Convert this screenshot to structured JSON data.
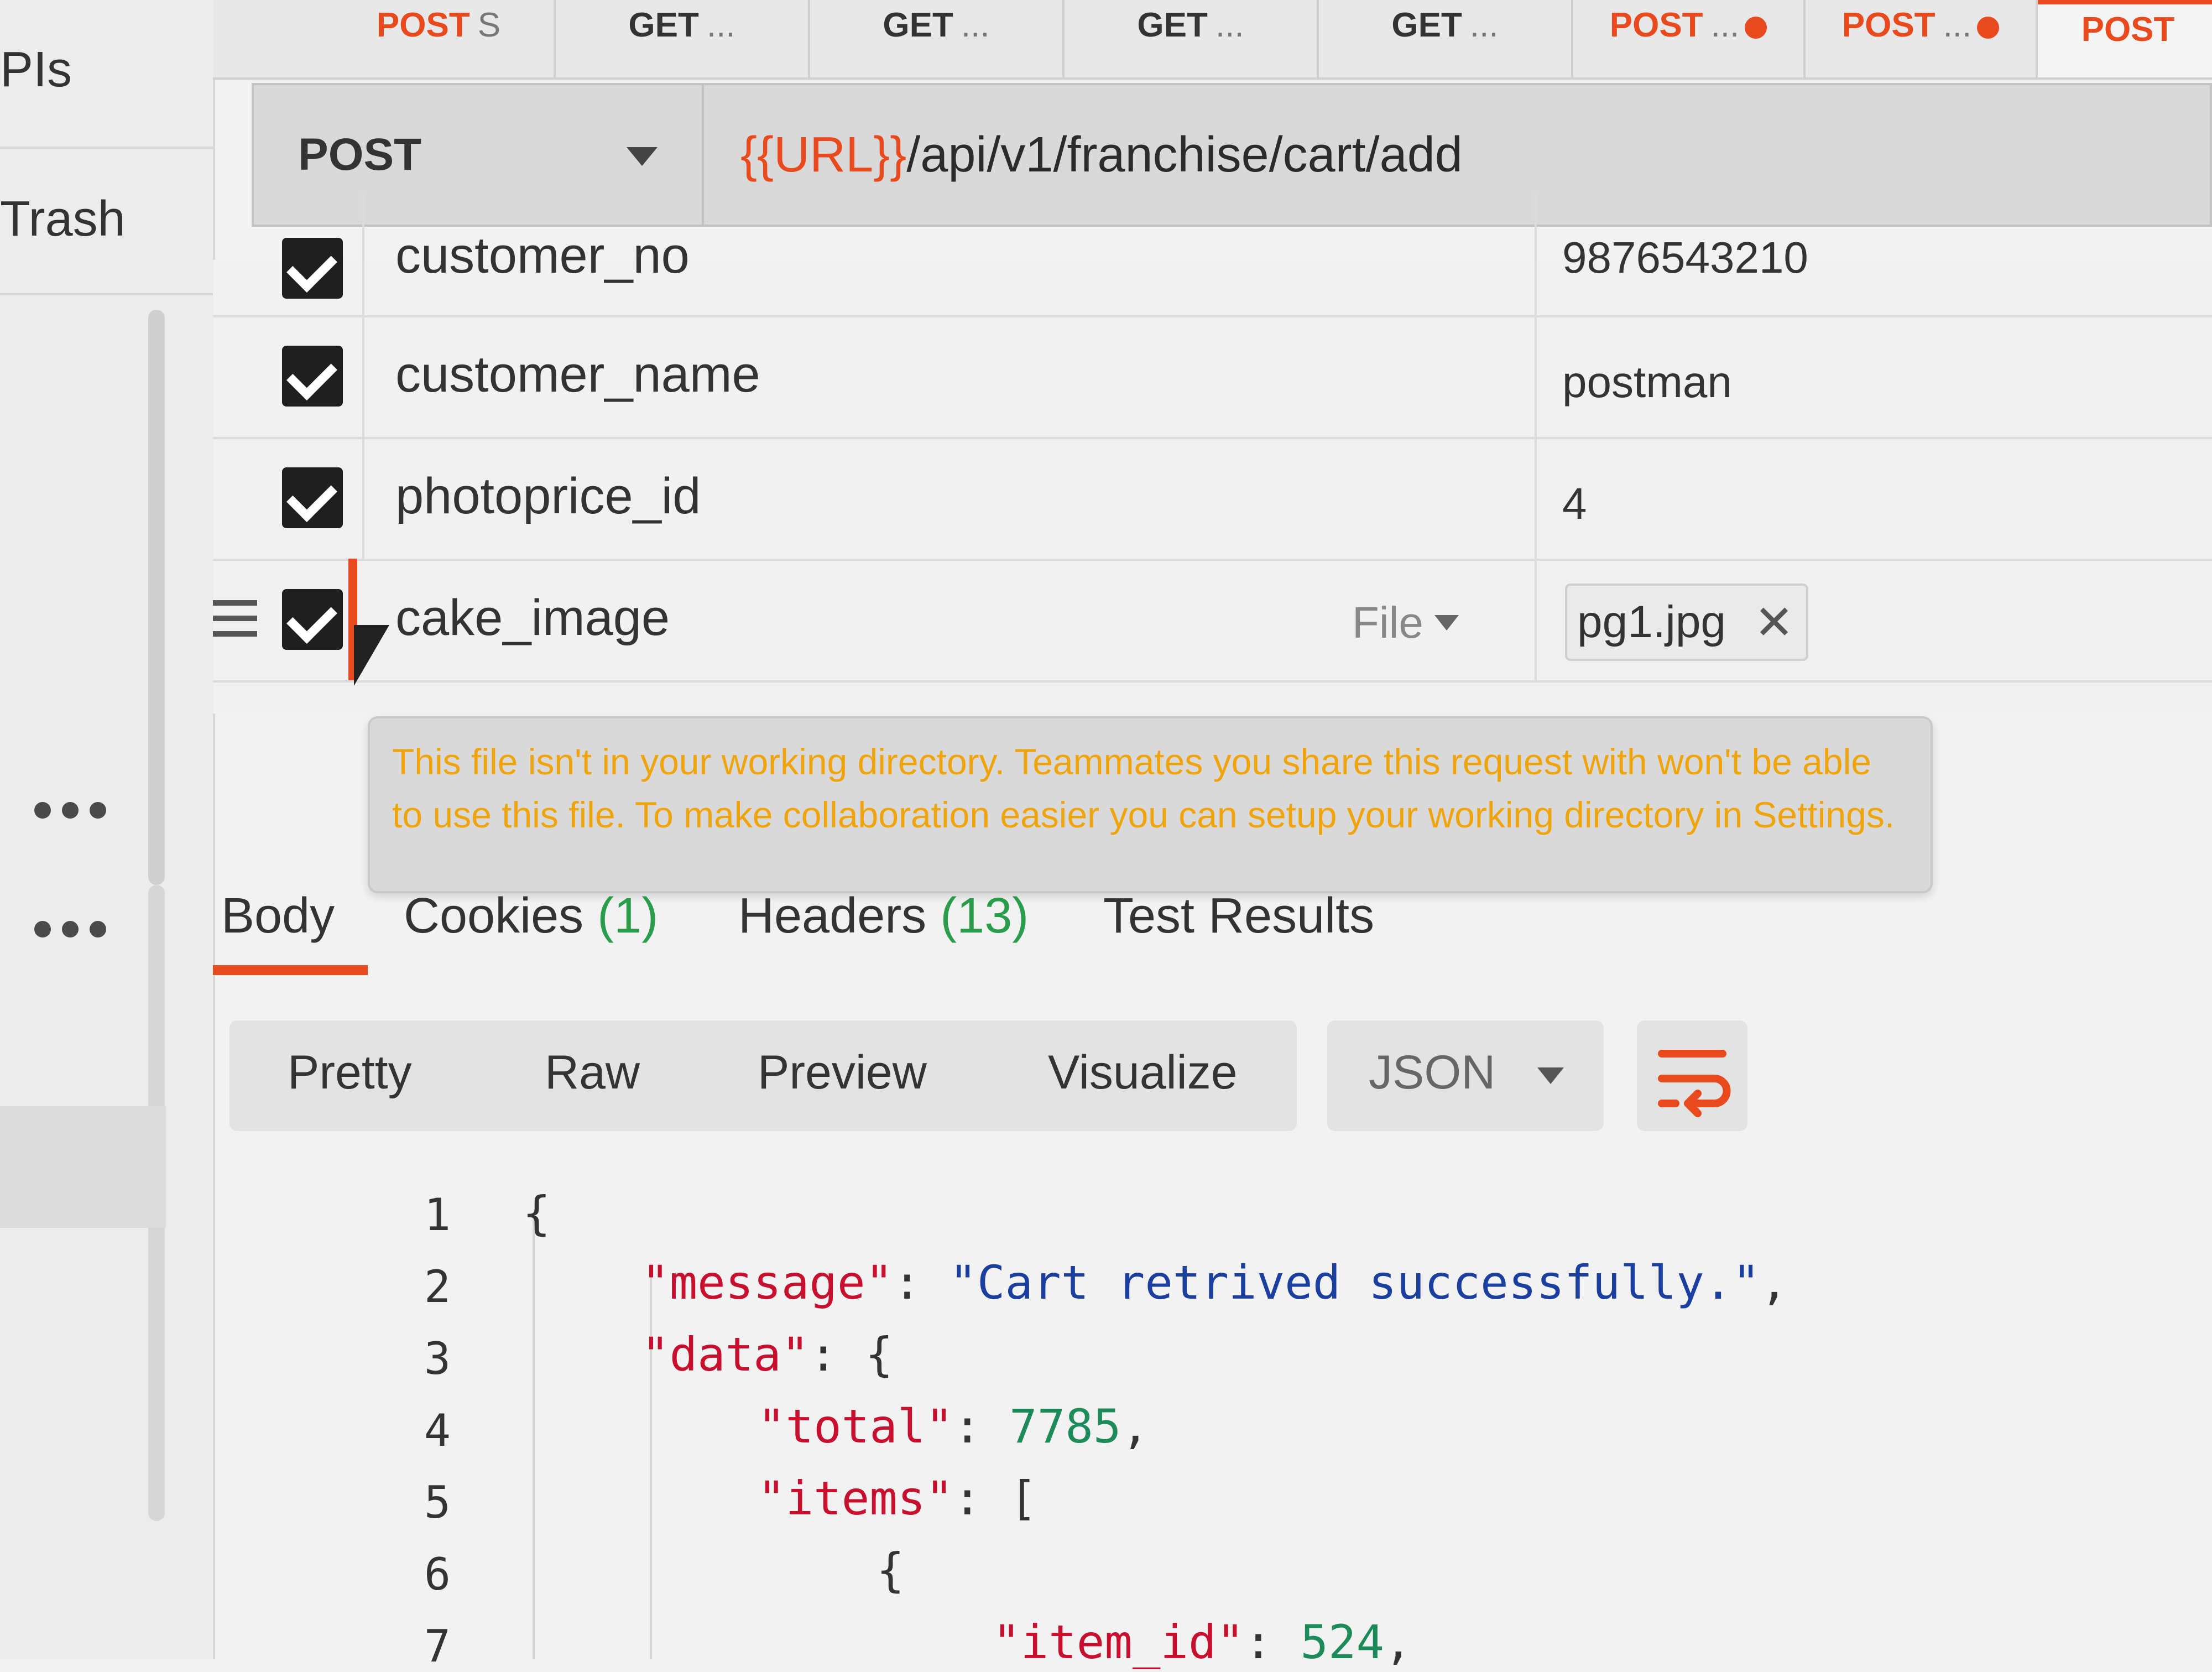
{
  "sidebar": {
    "item_apis": "PIs",
    "item_trash": "Trash"
  },
  "tabs": [
    {
      "method": "POST",
      "desc": "S",
      "unsaved": false
    },
    {
      "method": "GET",
      "desc": "...",
      "unsaved": false
    },
    {
      "method": "GET",
      "desc": "...",
      "unsaved": false
    },
    {
      "method": "GET",
      "desc": "...",
      "unsaved": false
    },
    {
      "method": "GET",
      "desc": "...",
      "unsaved": false
    },
    {
      "method": "POST",
      "desc": "...",
      "unsaved": true
    },
    {
      "method": "POST",
      "desc": "...",
      "unsaved": true
    },
    {
      "method": "POST",
      "desc": "",
      "unsaved": false
    }
  ],
  "request": {
    "method": "POST",
    "url_var": "{{URL}}",
    "url_path": "/api/v1/franchise/cart/add"
  },
  "params": [
    {
      "key": "customer_no",
      "value": "9876543210"
    },
    {
      "key": "customer_name",
      "value": "postman"
    },
    {
      "key": "photoprice_id",
      "value": "4"
    },
    {
      "key": "cake_image",
      "type": "File",
      "file": "pg1.jpg"
    }
  ],
  "tooltip": {
    "text": "This file isn't in your working directory. Teammates you share this request with won't be able to use this file. To make collaboration easier you can setup your working directory in Settings."
  },
  "response_tabs": [
    {
      "label": "Body",
      "count": ""
    },
    {
      "label": "Cookies",
      "count": "(1)"
    },
    {
      "label": "Headers",
      "count": "(13)"
    },
    {
      "label": "Test Results",
      "count": ""
    }
  ],
  "view_modes": [
    "Pretty",
    "Raw",
    "Preview",
    "Visualize"
  ],
  "format": "JSON",
  "code": {
    "line_numbers": [
      "1",
      "2",
      "3",
      "4",
      "5",
      "6",
      "7"
    ],
    "l1": "{",
    "l2_key": "\"message\"",
    "l2_val": "\"Cart retrived successfully.\"",
    "l3_key": "\"data\"",
    "l3_brace": "{",
    "l4_key": "\"total\"",
    "l4_val": "7785",
    "l5_key": "\"items\"",
    "l5_br": "[",
    "l6": "{",
    "l7_key": "\"item_id\"",
    "l7_val": "524"
  },
  "colors": {
    "accent": "#e8491d",
    "key": "#c8102e",
    "string": "#1b3f9e",
    "number": "#1d8a5a",
    "count": "#2a9d4b",
    "warning": "#f0a000"
  }
}
